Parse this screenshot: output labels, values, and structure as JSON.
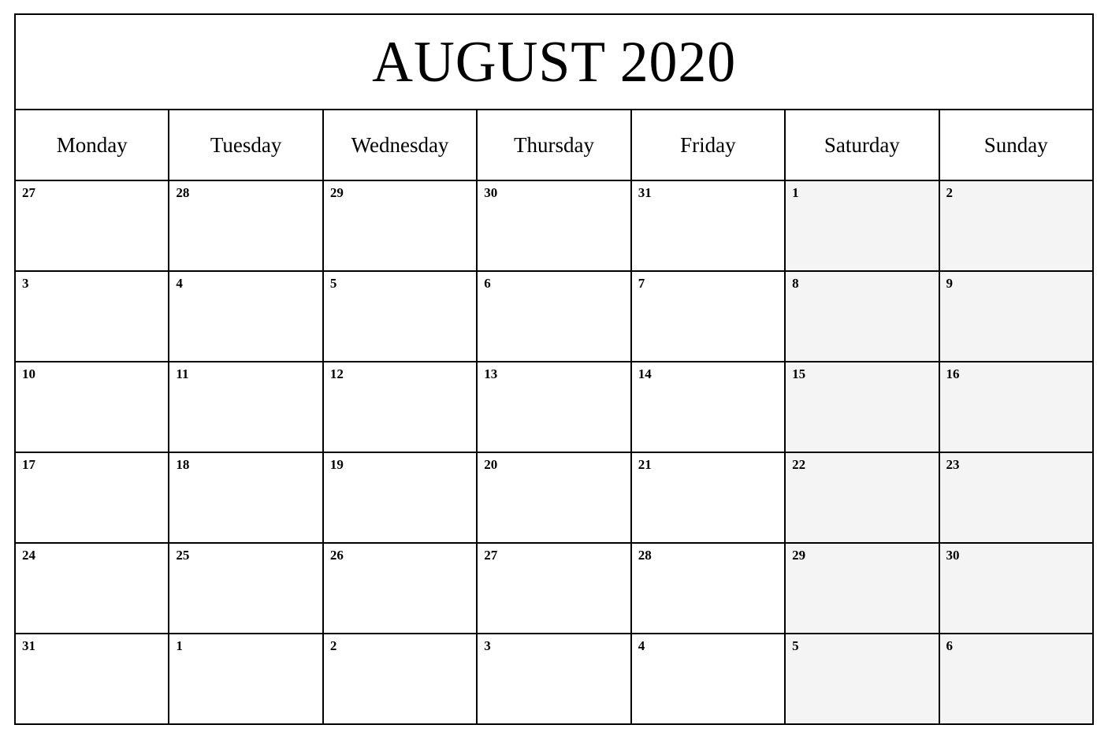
{
  "calendar": {
    "title": "AUGUST 2020",
    "month": "AUGUST",
    "year": "2020",
    "colors": {
      "border": "#000000",
      "page_background": "#ffffff",
      "cell_background": "#ffffff",
      "weekend_background": "#f4f4f4",
      "text": "#000000"
    },
    "weekdays": [
      {
        "label": "Monday",
        "weekend": false
      },
      {
        "label": "Tuesday",
        "weekend": false
      },
      {
        "label": "Wednesday",
        "weekend": false
      },
      {
        "label": "Thursday",
        "weekend": false
      },
      {
        "label": "Friday",
        "weekend": false
      },
      {
        "label": "Saturday",
        "weekend": true
      },
      {
        "label": "Sunday",
        "weekend": true
      }
    ],
    "weeks": [
      {
        "days": [
          {
            "number": "27",
            "in_month": false,
            "weekend": false,
            "notes": ""
          },
          {
            "number": "28",
            "in_month": false,
            "weekend": false,
            "notes": ""
          },
          {
            "number": "29",
            "in_month": false,
            "weekend": false,
            "notes": ""
          },
          {
            "number": "30",
            "in_month": false,
            "weekend": false,
            "notes": ""
          },
          {
            "number": "31",
            "in_month": false,
            "weekend": false,
            "notes": ""
          },
          {
            "number": "1",
            "in_month": true,
            "weekend": true,
            "notes": ""
          },
          {
            "number": "2",
            "in_month": true,
            "weekend": true,
            "notes": ""
          }
        ]
      },
      {
        "days": [
          {
            "number": "3",
            "in_month": true,
            "weekend": false,
            "notes": ""
          },
          {
            "number": "4",
            "in_month": true,
            "weekend": false,
            "notes": ""
          },
          {
            "number": "5",
            "in_month": true,
            "weekend": false,
            "notes": ""
          },
          {
            "number": "6",
            "in_month": true,
            "weekend": false,
            "notes": ""
          },
          {
            "number": "7",
            "in_month": true,
            "weekend": false,
            "notes": ""
          },
          {
            "number": "8",
            "in_month": true,
            "weekend": true,
            "notes": ""
          },
          {
            "number": "9",
            "in_month": true,
            "weekend": true,
            "notes": ""
          }
        ]
      },
      {
        "days": [
          {
            "number": "10",
            "in_month": true,
            "weekend": false,
            "notes": ""
          },
          {
            "number": "11",
            "in_month": true,
            "weekend": false,
            "notes": ""
          },
          {
            "number": "12",
            "in_month": true,
            "weekend": false,
            "notes": ""
          },
          {
            "number": "13",
            "in_month": true,
            "weekend": false,
            "notes": ""
          },
          {
            "number": "14",
            "in_month": true,
            "weekend": false,
            "notes": ""
          },
          {
            "number": "15",
            "in_month": true,
            "weekend": true,
            "notes": ""
          },
          {
            "number": "16",
            "in_month": true,
            "weekend": true,
            "notes": ""
          }
        ]
      },
      {
        "days": [
          {
            "number": "17",
            "in_month": true,
            "weekend": false,
            "notes": ""
          },
          {
            "number": "18",
            "in_month": true,
            "weekend": false,
            "notes": ""
          },
          {
            "number": "19",
            "in_month": true,
            "weekend": false,
            "notes": ""
          },
          {
            "number": "20",
            "in_month": true,
            "weekend": false,
            "notes": ""
          },
          {
            "number": "21",
            "in_month": true,
            "weekend": false,
            "notes": ""
          },
          {
            "number": "22",
            "in_month": true,
            "weekend": true,
            "notes": ""
          },
          {
            "number": "23",
            "in_month": true,
            "weekend": true,
            "notes": ""
          }
        ]
      },
      {
        "days": [
          {
            "number": "24",
            "in_month": true,
            "weekend": false,
            "notes": ""
          },
          {
            "number": "25",
            "in_month": true,
            "weekend": false,
            "notes": ""
          },
          {
            "number": "26",
            "in_month": true,
            "weekend": false,
            "notes": ""
          },
          {
            "number": "27",
            "in_month": true,
            "weekend": false,
            "notes": ""
          },
          {
            "number": "28",
            "in_month": true,
            "weekend": false,
            "notes": ""
          },
          {
            "number": "29",
            "in_month": true,
            "weekend": true,
            "notes": ""
          },
          {
            "number": "30",
            "in_month": true,
            "weekend": true,
            "notes": ""
          }
        ]
      },
      {
        "days": [
          {
            "number": "31",
            "in_month": true,
            "weekend": false,
            "notes": ""
          },
          {
            "number": "1",
            "in_month": false,
            "weekend": false,
            "notes": ""
          },
          {
            "number": "2",
            "in_month": false,
            "weekend": false,
            "notes": ""
          },
          {
            "number": "3",
            "in_month": false,
            "weekend": false,
            "notes": ""
          },
          {
            "number": "4",
            "in_month": false,
            "weekend": false,
            "notes": ""
          },
          {
            "number": "5",
            "in_month": false,
            "weekend": true,
            "notes": ""
          },
          {
            "number": "6",
            "in_month": false,
            "weekend": true,
            "notes": ""
          }
        ]
      }
    ]
  }
}
